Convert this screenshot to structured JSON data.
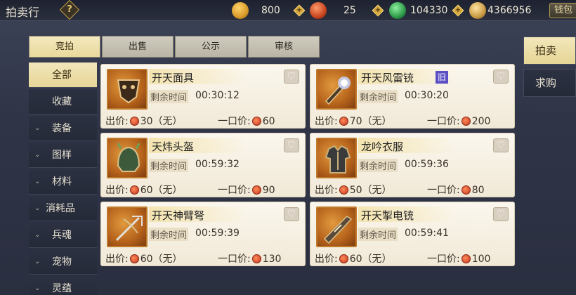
{
  "header": {
    "title": "拍卖行",
    "help_glyph": "?",
    "currencies": [
      {
        "icon": "gold-ingot-icon",
        "value": "800",
        "color": "#d99a2a"
      },
      {
        "icon": "red-orb-icon",
        "value": "25",
        "color": "#c8451f"
      },
      {
        "icon": "jade-coin-icon",
        "value": "104330",
        "color": "#2e9a4a"
      },
      {
        "icon": "silver-ingot-icon",
        "value": "4366956",
        "color": "#c99a45"
      }
    ],
    "plus_glyph": "+",
    "wallet_label": "钱包"
  },
  "tabs": [
    {
      "label": "竞拍",
      "active": true
    },
    {
      "label": "出售",
      "active": false
    },
    {
      "label": "公示",
      "active": false
    },
    {
      "label": "审核",
      "active": false
    }
  ],
  "sidebar": {
    "items": [
      {
        "label": "全部",
        "active": true,
        "expandable": false
      },
      {
        "label": "收藏",
        "active": false,
        "expandable": false
      },
      {
        "label": "装备",
        "active": false,
        "expandable": true
      },
      {
        "label": "图样",
        "active": false,
        "expandable": true
      },
      {
        "label": "材料",
        "active": false,
        "expandable": true
      },
      {
        "label": "消耗品",
        "active": false,
        "expandable": true
      },
      {
        "label": "兵魂",
        "active": false,
        "expandable": true
      },
      {
        "label": "宠物",
        "active": false,
        "expandable": true
      },
      {
        "label": "灵蕴",
        "active": false,
        "expandable": true
      }
    ],
    "chevron_glyph": "⌄"
  },
  "right_panel": {
    "items": [
      {
        "label": "拍卖",
        "active": true
      },
      {
        "label": "求购",
        "active": false
      }
    ]
  },
  "listings": {
    "time_label": "剩余时间",
    "bid_label": "出价:",
    "buyout_label": "一口价:",
    "no_bid_text": "（无）",
    "old_tag": "旧",
    "heart_glyph": "♡",
    "items": [
      {
        "name": "开天面具",
        "time": "00:30:12",
        "bid": "30",
        "buyout": "60",
        "icon": "mask-icon",
        "old": false
      },
      {
        "name": "开天风雷铳",
        "time": "00:30:20",
        "bid": "70",
        "buyout": "200",
        "icon": "thunder-gun-icon",
        "old": true
      },
      {
        "name": "天炜头盔",
        "time": "00:59:32",
        "bid": "60",
        "buyout": "90",
        "icon": "helmet-icon",
        "old": false
      },
      {
        "name": "龙吟衣服",
        "time": "00:59:36",
        "bid": "50",
        "buyout": "80",
        "icon": "armor-icon",
        "old": false
      },
      {
        "name": "开天神臂弩",
        "time": "00:59:39",
        "bid": "60",
        "buyout": "130",
        "icon": "crossbow-icon",
        "old": false
      },
      {
        "name": "开天掣电铳",
        "time": "00:59:41",
        "bid": "60",
        "buyout": "100",
        "icon": "lightning-gun-icon",
        "old": false
      }
    ]
  }
}
